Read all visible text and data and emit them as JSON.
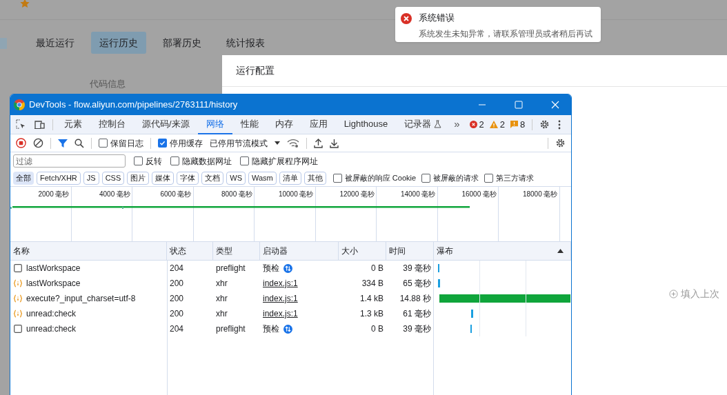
{
  "page": {
    "tabs": [
      {
        "label": "最近运行",
        "selected": false
      },
      {
        "label": "运行历史",
        "selected": true
      },
      {
        "label": "部署历史",
        "selected": false
      },
      {
        "label": "统计报表",
        "selected": false
      }
    ],
    "section_label": "代码信息",
    "panel": {
      "title": "运行配置",
      "fill_link": "填入上次"
    }
  },
  "toast": {
    "title": "系统错误",
    "message": "系统发生未知异常，请联系管理员或者稍后再试"
  },
  "devtools": {
    "title": "DevTools - flow.aliyun.com/pipelines/2763111/history",
    "tabs": [
      {
        "label": "元素",
        "selected": false
      },
      {
        "label": "控制台",
        "selected": false
      },
      {
        "label": "源代码/来源",
        "selected": false
      },
      {
        "label": "网络",
        "selected": true
      },
      {
        "label": "性能",
        "selected": false
      },
      {
        "label": "内存",
        "selected": false
      },
      {
        "label": "应用",
        "selected": false
      },
      {
        "label": "Lighthouse",
        "selected": false
      },
      {
        "label": "记录器",
        "selected": false
      }
    ],
    "more": "»",
    "badges": [
      {
        "kind": "error",
        "count": "2"
      },
      {
        "kind": "warning",
        "count": "2"
      },
      {
        "kind": "info",
        "count": "8"
      }
    ],
    "toolbar": {
      "recording": true,
      "preserve_log": {
        "label": "保留日志",
        "checked": false
      },
      "disable_cache": {
        "label": "停用缓存",
        "checked": true
      },
      "throttle": "已停用节流模式"
    },
    "filter": {
      "placeholder": "过滤",
      "options": [
        {
          "label": "反转",
          "checked": false
        },
        {
          "label": "隐藏数据网址",
          "checked": false
        },
        {
          "label": "隐藏扩展程序网址",
          "checked": false
        }
      ]
    },
    "types": [
      {
        "label": "全部",
        "selected": true
      },
      {
        "label": "Fetch/XHR",
        "selected": false
      },
      {
        "label": "JS",
        "selected": false
      },
      {
        "label": "CSS",
        "selected": false
      },
      {
        "label": "图片",
        "selected": false
      },
      {
        "label": "媒体",
        "selected": false
      },
      {
        "label": "字体",
        "selected": false
      },
      {
        "label": "文档",
        "selected": false
      },
      {
        "label": "WS",
        "selected": false
      },
      {
        "label": "Wasm",
        "selected": false
      },
      {
        "label": "清单",
        "selected": false
      },
      {
        "label": "其他",
        "selected": false
      }
    ],
    "type_options": [
      {
        "label": "被屏蔽的响应 Cookie",
        "checked": false
      },
      {
        "label": "被屏蔽的请求",
        "checked": false
      },
      {
        "label": "第三方请求",
        "checked": false
      }
    ],
    "timeline_ticks": [
      "2000 毫秒",
      "4000 毫秒",
      "6000 毫秒",
      "8000 毫秒",
      "10000 毫秒",
      "12000 毫秒",
      "14000 毫秒",
      "16000 毫秒",
      "18000 毫秒"
    ],
    "columns": [
      "名称",
      "状态",
      "类型",
      "启动器",
      "大小",
      "时间",
      "瀑布"
    ],
    "requests": [
      {
        "kind": "preflight",
        "name": "lastWorkspace",
        "status": "204",
        "type": "preflight",
        "initiator": "预检",
        "size": "0 B",
        "time": "39 毫秒"
      },
      {
        "kind": "xhr",
        "name": "lastWorkspace",
        "status": "200",
        "type": "xhr",
        "initiator": "index.js:1",
        "size": "334 B",
        "time": "65 毫秒"
      },
      {
        "kind": "xhr",
        "name": "execute?_input_charset=utf-8",
        "status": "200",
        "type": "xhr",
        "initiator": "index.js:1",
        "size": "1.4 kB",
        "time": "14.88 秒"
      },
      {
        "kind": "xhr",
        "name": "unread:check",
        "status": "200",
        "type": "xhr",
        "initiator": "index.js:1",
        "size": "1.3 kB",
        "time": "61 毫秒"
      },
      {
        "kind": "preflight",
        "name": "unread:check",
        "status": "204",
        "type": "preflight",
        "initiator": "预检",
        "size": "0 B",
        "time": "39 毫秒"
      }
    ]
  }
}
